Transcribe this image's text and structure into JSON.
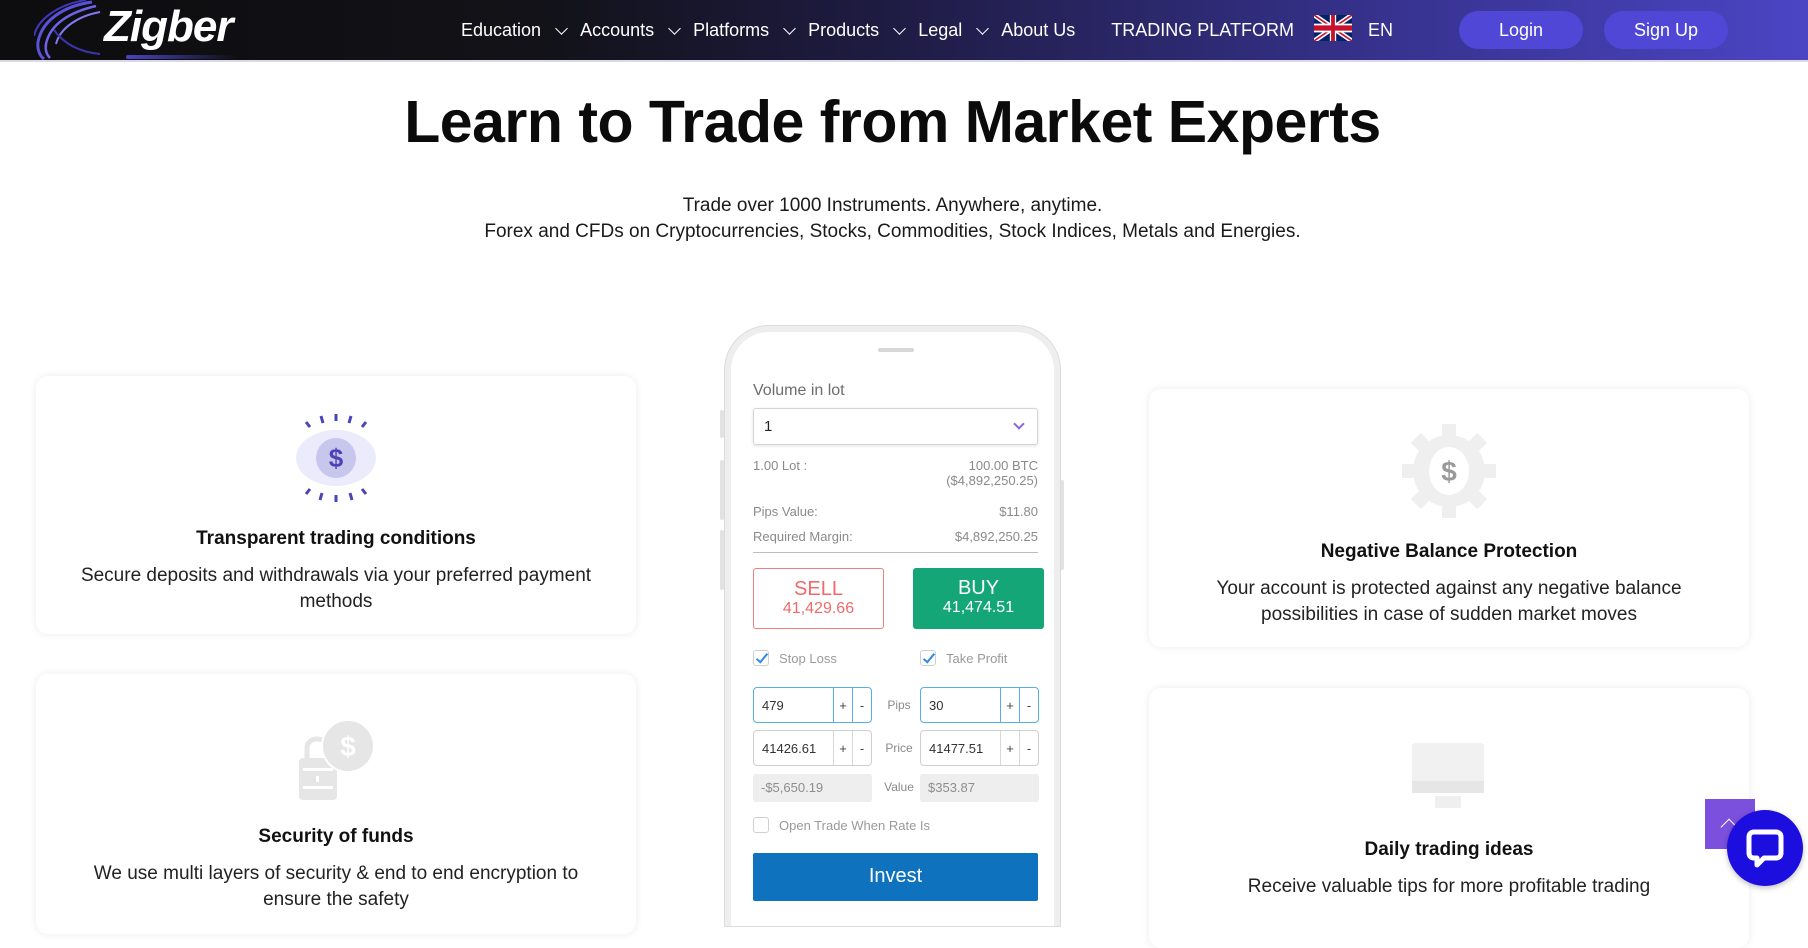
{
  "nav": {
    "brand": "Zigber",
    "items": [
      {
        "label": "Education",
        "has_dropdown": true
      },
      {
        "label": "Accounts",
        "has_dropdown": true
      },
      {
        "label": "Platforms",
        "has_dropdown": true
      },
      {
        "label": "Products",
        "has_dropdown": true
      },
      {
        "label": "Legal",
        "has_dropdown": true
      },
      {
        "label": "About Us",
        "has_dropdown": false
      },
      {
        "label": "TRADING PLATFORM",
        "has_dropdown": false
      }
    ],
    "language": {
      "code": "EN",
      "flag_icon": "uk-flag-icon"
    },
    "login_label": "Login",
    "signup_label": "Sign Up"
  },
  "hero": {
    "title": "Learn to Trade from Market Experts",
    "subtitle_line1": "Trade over 1000 Instruments. Anywhere, anytime.",
    "subtitle_line2": "Forex and CFDs on Cryptocurrencies, Stocks, Commodities, Stock Indices, Metals and Energies."
  },
  "features": [
    {
      "icon": "dollar-eye-icon",
      "title": "Transparent trading conditions",
      "description": "Secure deposits and withdrawals via your preferred payment methods"
    },
    {
      "icon": "lock-dollar-icon",
      "title": "Security of funds",
      "description": "We use multi layers of security & end to end encryption to ensure the safety"
    },
    {
      "icon": "gear-dollar-icon",
      "title": "Negative Balance Protection",
      "description": "Your account is protected against any negative balance possibilities in case of sudden market moves"
    },
    {
      "icon": "monitor-icon",
      "title": "Daily trading ideas",
      "description": "Receive valuable tips for more profitable trading"
    }
  ],
  "phone": {
    "volume_label": "Volume in lot",
    "volume_value": "1",
    "lot_label": "1.00 Lot :",
    "lot_value": "100.00 BTC",
    "lot_value_usd": "($4,892,250.25)",
    "pips_value_label": "Pips Value:",
    "pips_value": "$11.80",
    "margin_label": "Required Margin:",
    "margin_value": "$4,892,250.25",
    "sell_label": "SELL",
    "sell_price": "41,429.66",
    "buy_label": "BUY",
    "buy_price": "41,474.51",
    "stop_loss_label": "Stop Loss",
    "stop_loss_checked": true,
    "take_profit_label": "Take Profit",
    "take_profit_checked": true,
    "pips_label": "Pips",
    "price_label": "Price",
    "value_label": "Value",
    "sl_pips": "479",
    "tp_pips": "30",
    "sl_price": "41426.61",
    "tp_price": "41477.51",
    "sl_value": "-$5,650.19",
    "tp_value": "$353.87",
    "plus": "+",
    "minus": "-",
    "open_trade_label": "Open Trade When Rate Is",
    "open_trade_checked": false,
    "invest_label": "Invest"
  },
  "colors": {
    "accent": "#5047d6",
    "buy": "#14a676",
    "sell": "#ef6b6b",
    "invest": "#0e72be",
    "chat": "#1d0ee0",
    "scroll_top": "#7b50dc"
  }
}
